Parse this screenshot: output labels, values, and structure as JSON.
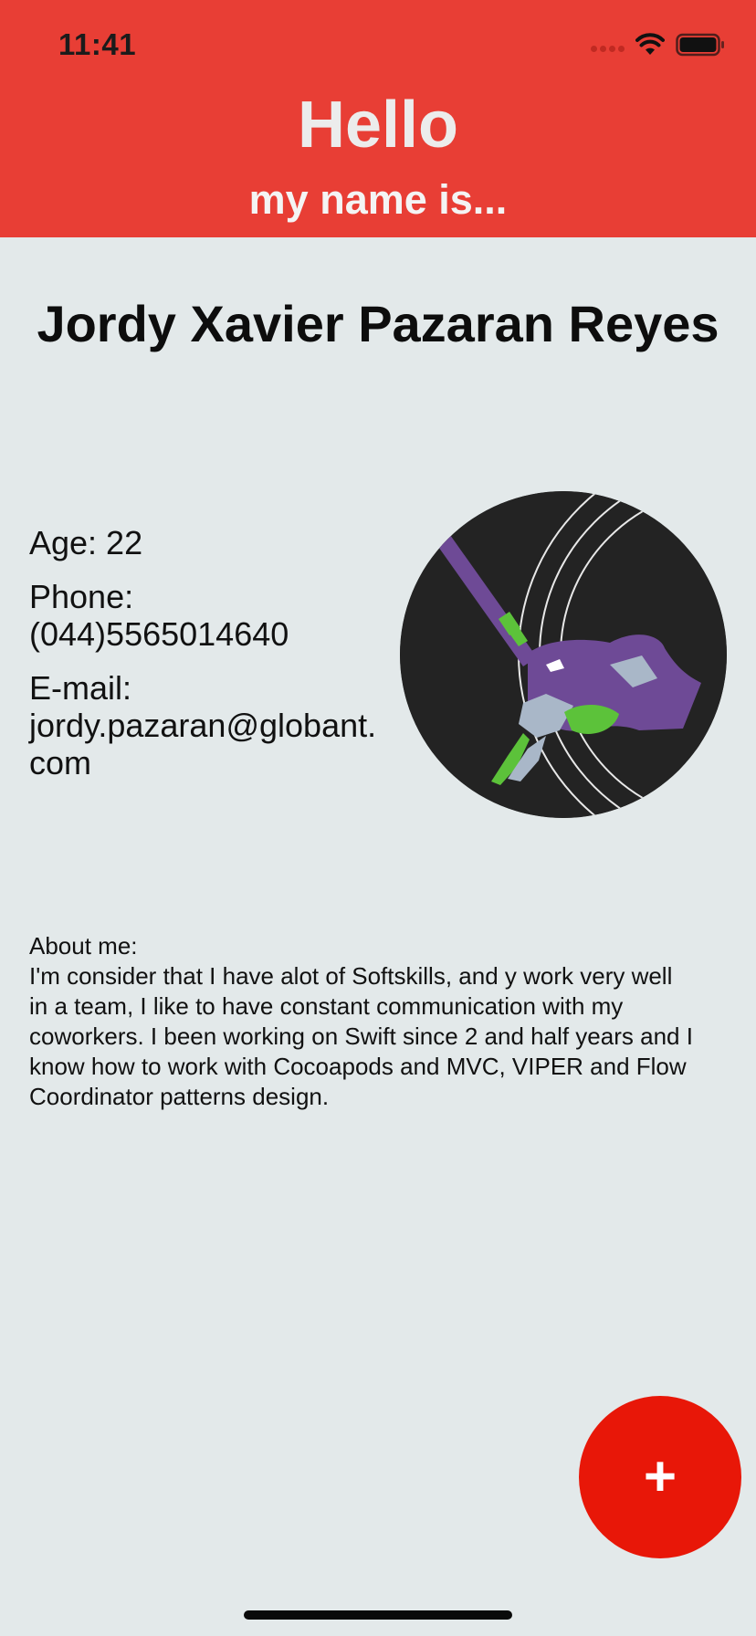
{
  "status_bar": {
    "time": "11:41"
  },
  "header": {
    "title": "Hello",
    "subtitle": "my name is..."
  },
  "profile": {
    "name": "Jordy Xavier Pazaran Reyes",
    "age": "Age: 22",
    "phone_label": "Phone:",
    "phone": "(044)5565014640",
    "email_label": "E-mail:",
    "email_line1": "jordy.pazaran@globant.",
    "email_line2": "com",
    "avatar_icon": "eva-unit-01-avatar"
  },
  "about": {
    "label": "About me:",
    "text": "I'm consider that I have alot of Softskills, and y work very well in a team, I like to have constant communication with my coworkers. I been working on Swift since 2 and half years and I know how to work with Cocoapods and MVC, VIPER and Flow Coordinator patterns design."
  },
  "fab": {
    "label": "+"
  },
  "colors": {
    "header": "#e83e35",
    "background": "#e3e9ea",
    "fab": "#e81708",
    "accent_purple": "#6e4a96",
    "accent_green": "#5cc23a"
  }
}
